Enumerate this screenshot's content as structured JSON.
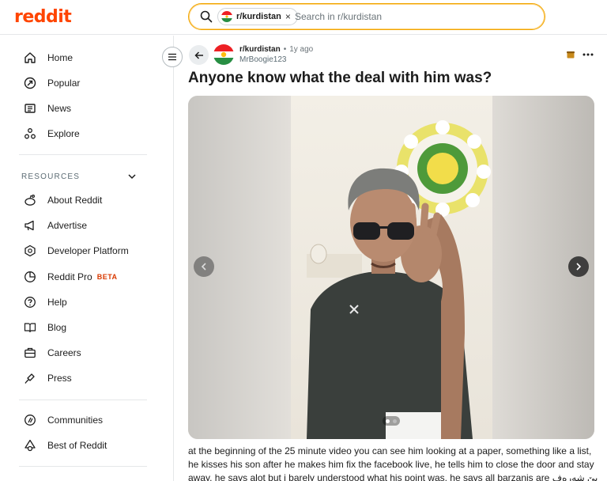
{
  "header": {
    "logo": "reddit",
    "search_chip": "r/kurdistan",
    "search_chip_close": "×",
    "search_placeholder": "Search in r/kurdistan"
  },
  "sidebar": {
    "main_items": [
      {
        "label": "Home",
        "icon": "home-icon"
      },
      {
        "label": "Popular",
        "icon": "popular-icon"
      },
      {
        "label": "News",
        "icon": "news-icon"
      },
      {
        "label": "Explore",
        "icon": "explore-icon"
      }
    ],
    "resources_heading": "RESOURCES",
    "resource_items": [
      {
        "label": "About Reddit",
        "icon": "reddit-icon"
      },
      {
        "label": "Advertise",
        "icon": "megaphone-icon"
      },
      {
        "label": "Developer Platform",
        "icon": "developer-icon"
      },
      {
        "label": "Reddit Pro",
        "icon": "pro-icon",
        "badge": "BETA"
      },
      {
        "label": "Help",
        "icon": "help-icon"
      },
      {
        "label": "Blog",
        "icon": "blog-icon"
      },
      {
        "label": "Careers",
        "icon": "briefcase-icon"
      },
      {
        "label": "Press",
        "icon": "press-icon"
      }
    ],
    "bottom_items": [
      {
        "label": "Communities",
        "icon": "communities-icon"
      },
      {
        "label": "Best of Reddit",
        "icon": "best-icon"
      }
    ]
  },
  "post": {
    "subreddit": "r/kurdistan",
    "separator": "•",
    "age": "1y ago",
    "author": "MrBoogie123",
    "title": "Anyone know what the deal with him was?",
    "body_lines": [
      "at the beginning of the 25 minute video you can see him looking at a paper, something like a list,",
      "he kisses his son after he makes him fix the facebook live, he tells him to close the door and stay",
      "away. he says alot but i barely understood what his point was, he says all barzanis are بێ شەرەف"
    ],
    "gallery": {
      "count": 2,
      "active_index": 0
    }
  },
  "colors": {
    "brand": "#ff4500",
    "search_border": "#f0a500",
    "beta": "#d93900",
    "flag_red": "#ed2024",
    "flag_white": "#ffffff",
    "flag_green": "#278e43",
    "flag_sun": "#febd11"
  }
}
